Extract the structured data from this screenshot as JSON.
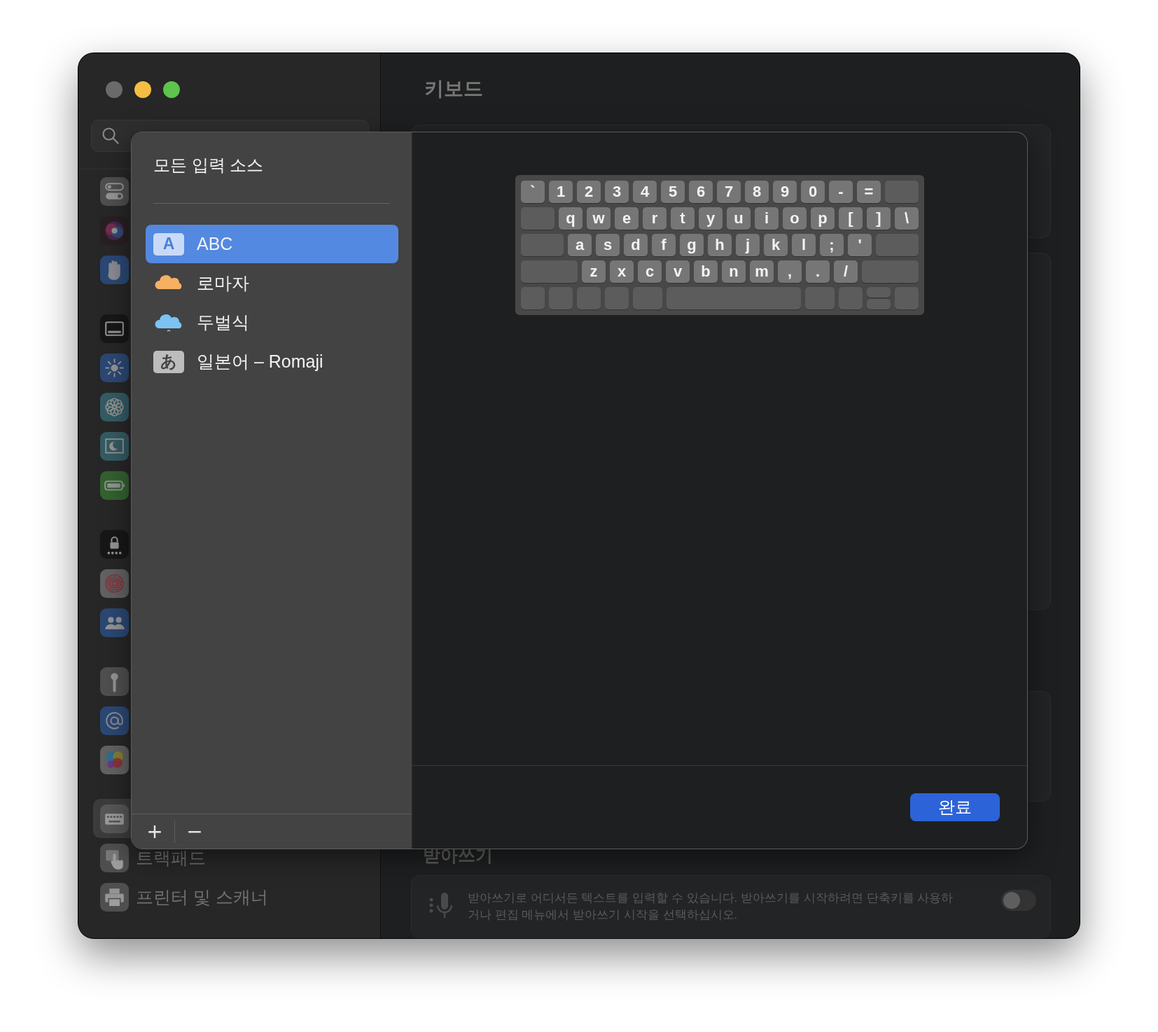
{
  "window": {
    "title": "키보드"
  },
  "sidebar": {
    "groups": [
      {
        "items": [
          {
            "selected": false
          },
          {
            "selected": false
          },
          {
            "selected": false
          }
        ]
      },
      {
        "items": [
          {
            "selected": false
          },
          {
            "selected": false
          },
          {
            "selected": false
          },
          {
            "selected": false
          },
          {
            "selected": false
          }
        ]
      },
      {
        "items": [
          {
            "selected": false
          },
          {
            "selected": false
          },
          {
            "selected": false
          }
        ]
      },
      {
        "items": [
          {
            "selected": false
          },
          {
            "selected": false
          },
          {
            "selected": false
          }
        ]
      },
      {
        "items": [
          {
            "selected": true
          },
          {
            "label": "트랙패드",
            "selected": false
          },
          {
            "label": "프린터 및 스캐너",
            "selected": false
          }
        ]
      }
    ]
  },
  "dictation": {
    "heading": "받아쓰기",
    "text": "받아쓰기로 어디서든 텍스트를 입력할 수 있습니다. 받아쓰기를 시작하려면 단축키를 사용하거나 편집 메뉴에서 받아쓰기 시작을 선택하십시오.",
    "on": false
  },
  "sheet": {
    "title": "모든 입력 소스",
    "sources": [
      {
        "kind": "letter",
        "badge": "A",
        "label": "ABC",
        "selected": true
      },
      {
        "kind": "cloud",
        "color": "#f5b063",
        "label": "로마자",
        "selected": false
      },
      {
        "kind": "cloud",
        "color": "#7cc3f2",
        "label": "두벌식",
        "selected": false
      },
      {
        "kind": "letter",
        "badge": "あ",
        "label": "일본어 – Romaji",
        "selected": false
      }
    ],
    "footer_buttons": [
      "+",
      "−"
    ],
    "keyboard": {
      "rows": [
        [
          "`",
          "1",
          "2",
          "3",
          "4",
          "5",
          "6",
          "7",
          "8",
          "9",
          "0",
          "-",
          "="
        ],
        [
          "q",
          "w",
          "e",
          "r",
          "t",
          "y",
          "u",
          "i",
          "o",
          "p",
          "[",
          "]",
          "\\"
        ],
        [
          "a",
          "s",
          "d",
          "f",
          "g",
          "h",
          "j",
          "k",
          "l",
          ";",
          "'"
        ],
        [
          "z",
          "x",
          "c",
          "v",
          "b",
          "n",
          "m",
          ",",
          ".",
          "/"
        ]
      ]
    },
    "done_button": "완료"
  }
}
